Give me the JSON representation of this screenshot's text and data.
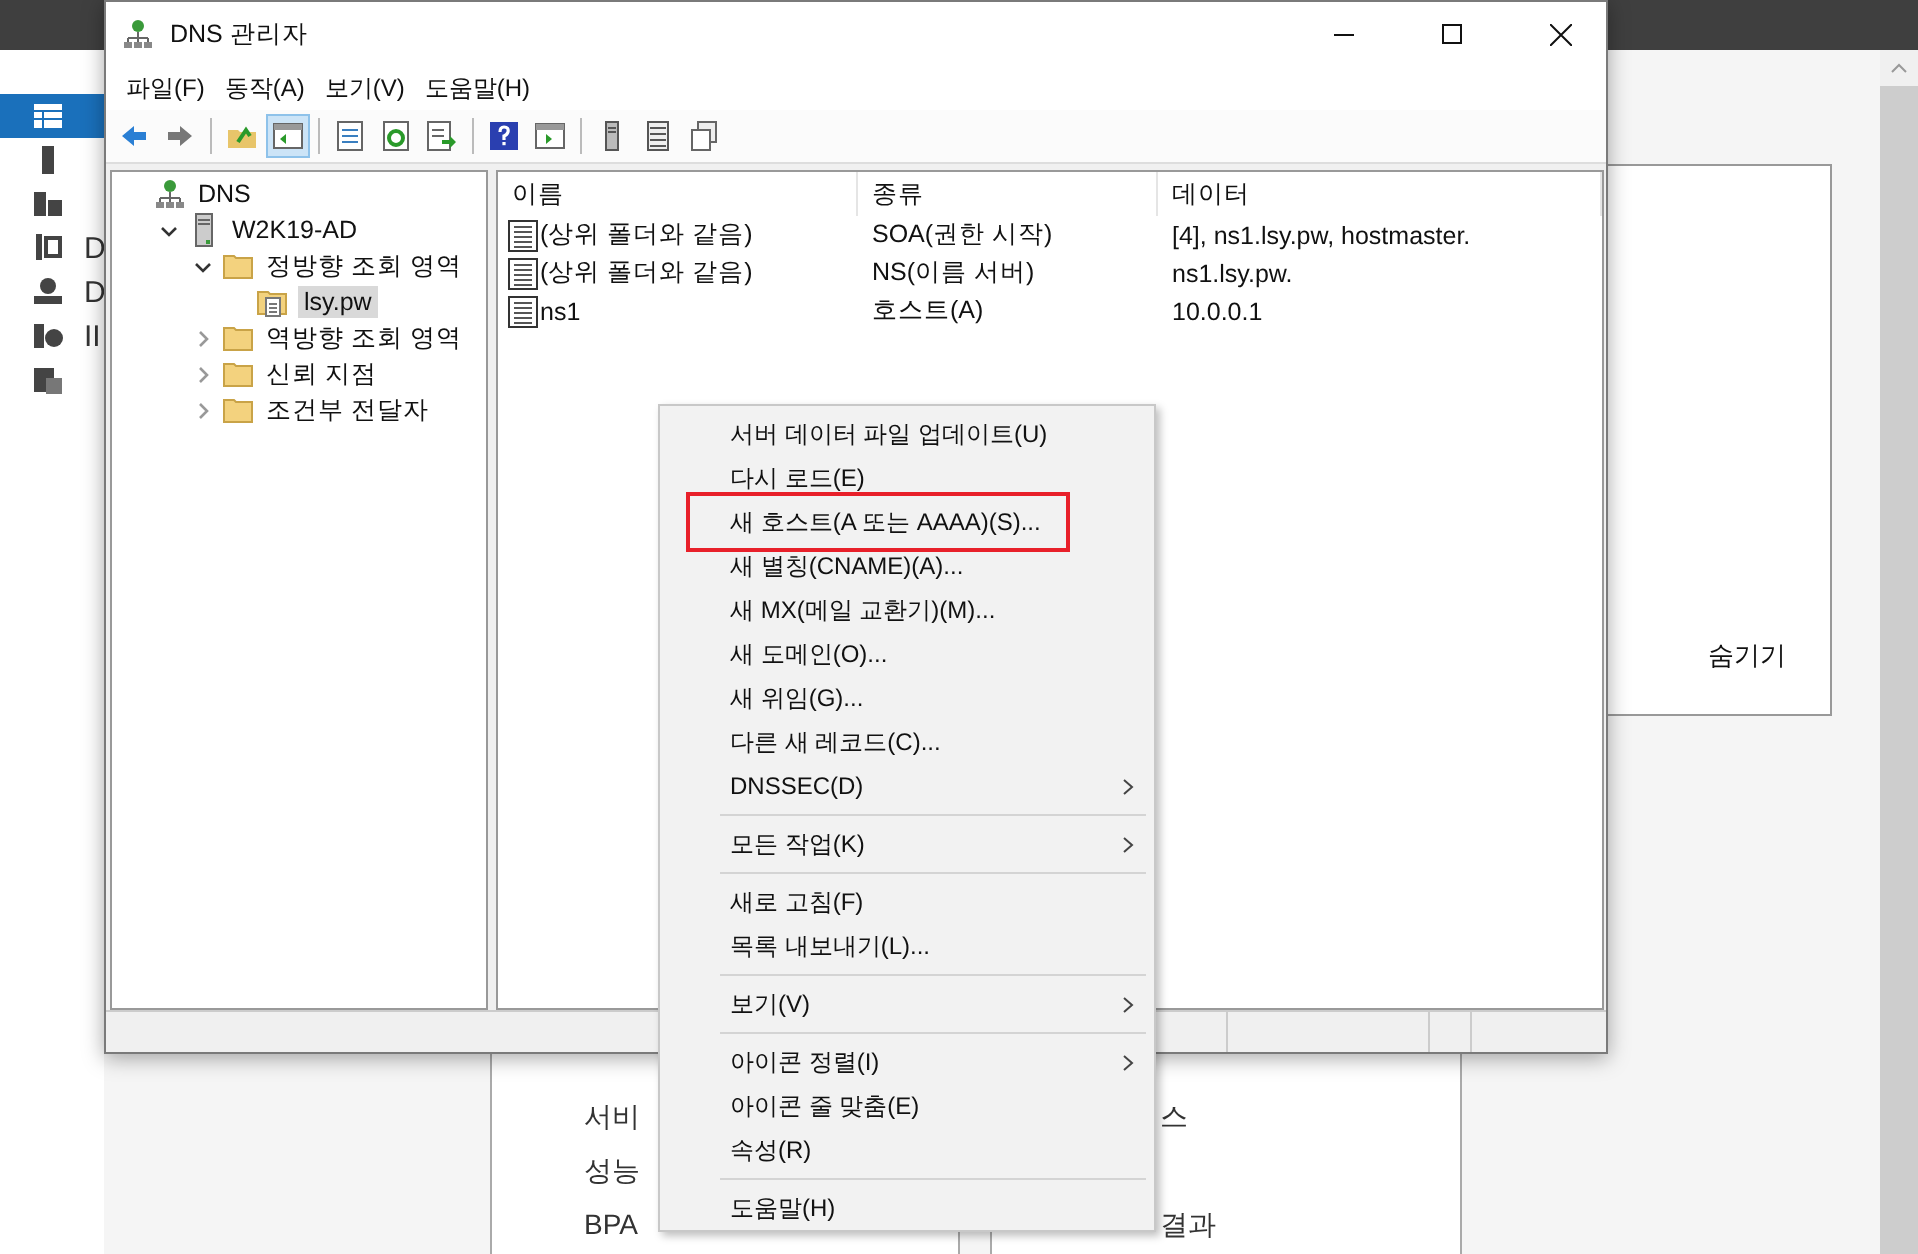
{
  "background": {
    "sidebar": [
      {
        "selected": true,
        "kind": "dashboard"
      },
      {
        "selected": false,
        "kind": "server"
      },
      {
        "selected": false,
        "kind": "servers"
      },
      {
        "label": "D",
        "selected": false,
        "kind": "tools"
      },
      {
        "label": "D",
        "selected": false,
        "kind": "dns"
      },
      {
        "label": "II",
        "selected": false,
        "kind": "iis"
      },
      {
        "selected": false,
        "kind": "files"
      }
    ],
    "hide_link": "숨기기",
    "tile_left": [
      "서비",
      "성능",
      "BPA"
    ],
    "tile_right": [
      "스",
      "결과"
    ]
  },
  "window": {
    "title": "DNS 관리자",
    "menu": [
      "파일(F)",
      "동작(A)",
      "보기(V)",
      "도움말(H)"
    ],
    "toolbar": [
      {
        "kind": "back",
        "selected": false
      },
      {
        "kind": "forward",
        "selected": false
      },
      {
        "kind": "sep"
      },
      {
        "kind": "up",
        "selected": false
      },
      {
        "kind": "tree",
        "selected": true
      },
      {
        "kind": "sep"
      },
      {
        "kind": "props",
        "selected": false
      },
      {
        "kind": "refresh",
        "selected": false
      },
      {
        "kind": "export",
        "selected": false
      },
      {
        "kind": "sep"
      },
      {
        "kind": "help",
        "selected": false
      },
      {
        "kind": "pane",
        "selected": false
      },
      {
        "kind": "sep"
      },
      {
        "kind": "server",
        "selected": false
      },
      {
        "kind": "list",
        "selected": false
      },
      {
        "kind": "copy",
        "selected": false
      }
    ],
    "tree": [
      {
        "label": "DNS",
        "kind": "root",
        "selected": false,
        "children": [
          {
            "label": "W2K19-AD",
            "kind": "server",
            "expanded": true,
            "selected": false,
            "children": [
              {
                "label": "정방향 조회 영역",
                "kind": "folder",
                "expanded": true,
                "selected": false,
                "children": [
                  {
                    "label": "lsy.pw",
                    "kind": "zone",
                    "selected": true
                  }
                ]
              },
              {
                "label": "역방향 조회 영역",
                "kind": "folder",
                "expanded": false,
                "selected": false
              },
              {
                "label": "신뢰 지점",
                "kind": "folder",
                "expanded": false,
                "selected": false
              },
              {
                "label": "조건부 전달자",
                "kind": "folder",
                "expanded": false,
                "selected": false
              }
            ]
          }
        ]
      }
    ],
    "columns": [
      "이름",
      "종류",
      "데이터"
    ],
    "rows": [
      {
        "name": "(상위 폴더와 같음)",
        "type": "SOA(권한 시작)",
        "data": "[4], ns1.lsy.pw, hostmaster."
      },
      {
        "name": "(상위 폴더와 같음)",
        "type": "NS(이름 서버)",
        "data": "ns1.lsy.pw."
      },
      {
        "name": "ns1",
        "type": "호스트(A)",
        "data": "10.0.0.1"
      }
    ]
  },
  "context_menu": [
    {
      "kind": "item",
      "label": "서버 데이터 파일 업데이트(U)",
      "submenu": false,
      "highlighted": false
    },
    {
      "kind": "item",
      "label": "다시 로드(E)",
      "submenu": false,
      "highlighted": false
    },
    {
      "kind": "item",
      "label": "새 호스트(A 또는 AAAA)(S)...",
      "submenu": false,
      "highlighted": true
    },
    {
      "kind": "item",
      "label": "새 별칭(CNAME)(A)...",
      "submenu": false,
      "highlighted": false
    },
    {
      "kind": "item",
      "label": "새 MX(메일 교환기)(M)...",
      "submenu": false,
      "highlighted": false
    },
    {
      "kind": "item",
      "label": "새 도메인(O)...",
      "submenu": false,
      "highlighted": false
    },
    {
      "kind": "item",
      "label": "새 위임(G)...",
      "submenu": false,
      "highlighted": false
    },
    {
      "kind": "item",
      "label": "다른 새 레코드(C)...",
      "submenu": false,
      "highlighted": false
    },
    {
      "kind": "item",
      "label": "DNSSEC(D)",
      "submenu": true,
      "highlighted": false
    },
    {
      "kind": "separator"
    },
    {
      "kind": "item",
      "label": "모든 작업(K)",
      "submenu": true,
      "highlighted": false
    },
    {
      "kind": "separator"
    },
    {
      "kind": "item",
      "label": "새로 고침(F)",
      "submenu": false,
      "highlighted": false
    },
    {
      "kind": "item",
      "label": "목록 내보내기(L)...",
      "submenu": false,
      "highlighted": false
    },
    {
      "kind": "separator"
    },
    {
      "kind": "item",
      "label": "보기(V)",
      "submenu": true,
      "highlighted": false
    },
    {
      "kind": "separator"
    },
    {
      "kind": "item",
      "label": "아이콘 정렬(I)",
      "submenu": true,
      "highlighted": false
    },
    {
      "kind": "item",
      "label": "아이콘 줄 맞춤(E)",
      "submenu": false,
      "highlighted": false
    },
    {
      "kind": "item",
      "label": "속성(R)",
      "submenu": false,
      "highlighted": false
    },
    {
      "kind": "separator"
    },
    {
      "kind": "item",
      "label": "도움말(H)",
      "submenu": false,
      "highlighted": false
    }
  ]
}
